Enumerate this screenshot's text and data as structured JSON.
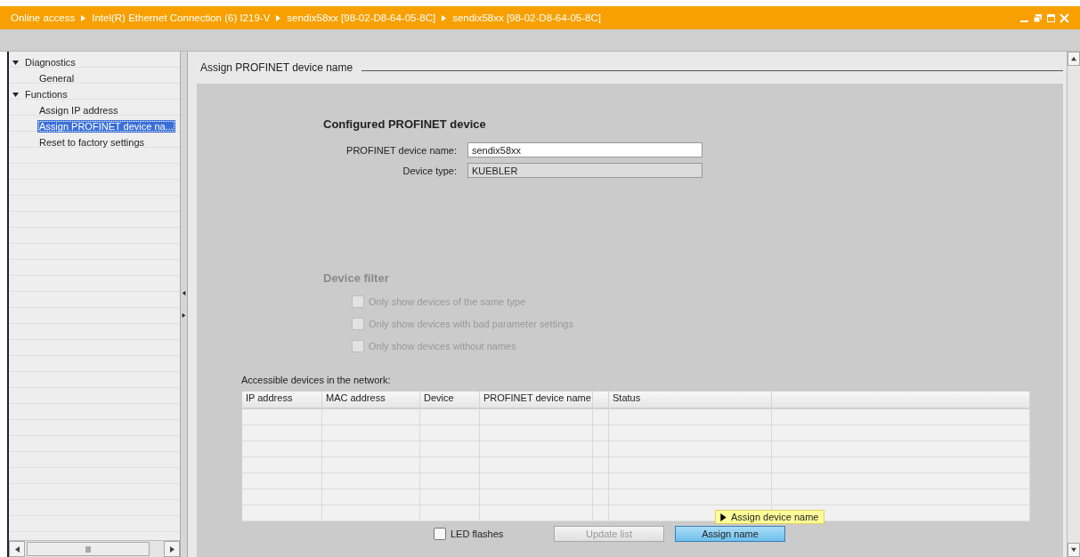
{
  "title_bar": {
    "breadcrumb": [
      "Online access",
      "Intel(R) Ethernet Connection (6) I219-V",
      "sendix58xx [98-02-D8-64-05-8C]",
      "sendix58xx [98-02-D8-64-05-8C]"
    ]
  },
  "sidebar": {
    "items": [
      {
        "label": "Diagnostics",
        "expanded": true,
        "children": [
          {
            "label": "General",
            "selected": false
          }
        ]
      },
      {
        "label": "Functions",
        "expanded": true,
        "children": [
          {
            "label": "Assign IP address",
            "selected": false
          },
          {
            "label": "Assign PROFINET device na...",
            "selected": true
          },
          {
            "label": "Reset to factory settings",
            "selected": false
          }
        ]
      }
    ]
  },
  "section_title": "Assign PROFINET device name",
  "configured": {
    "heading": "Configured PROFINET device",
    "fields": [
      {
        "label": "PROFINET device name:",
        "value": "sendix58xx",
        "disabled": false
      },
      {
        "label": "Device type:",
        "value": "KUEBLER",
        "disabled": true
      }
    ]
  },
  "device_filter": {
    "heading": "Device filter",
    "disabled": true,
    "options": [
      {
        "label": "Only show devices of the same type",
        "checked": false
      },
      {
        "label": "Only show devices with bad parameter settings",
        "checked": false
      },
      {
        "label": "Only show devices without names",
        "checked": false
      }
    ]
  },
  "devices_table": {
    "caption": "Accessible devices in the network:",
    "columns": [
      {
        "kind": "heading",
        "label": "IP address"
      },
      {
        "kind": "heading",
        "label": "MAC address"
      },
      {
        "kind": "heading",
        "label": "Device"
      },
      {
        "kind": "heading",
        "label": "PROFINET device name"
      },
      {
        "kind": "blank"
      },
      {
        "kind": "heading",
        "label": "Status"
      },
      {
        "kind": "blank"
      }
    ]
  },
  "led_flashes": {
    "label": "LED flashes",
    "checked": false
  },
  "buttons": [
    {
      "label": "Update list",
      "disabled": true,
      "highlighted": false
    },
    {
      "label": "Assign name",
      "disabled": false,
      "highlighted": true
    }
  ],
  "tooltip": {
    "text": "Assign device name"
  }
}
